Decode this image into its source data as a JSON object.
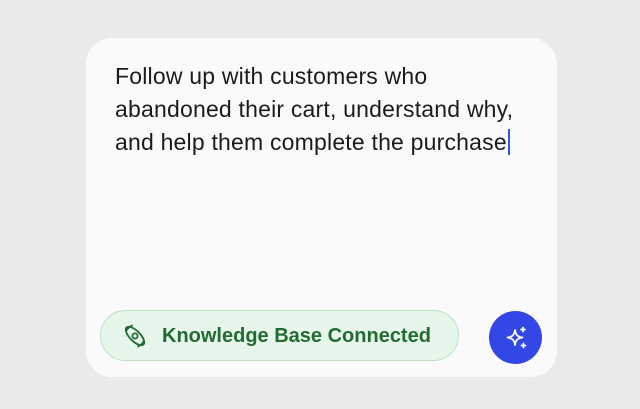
{
  "composer": {
    "text": "Follow up with customers who abandoned their cart, understand why, and help them complete the purchase",
    "caret_color": "#3355e0"
  },
  "knowledge_base": {
    "label": "Knowledge Base Connected",
    "icon": "orbit-icon",
    "text_color": "#226b33",
    "background": "#e6f6ea"
  },
  "ai_button": {
    "icon": "sparkles-icon",
    "background": "#3347e6"
  }
}
